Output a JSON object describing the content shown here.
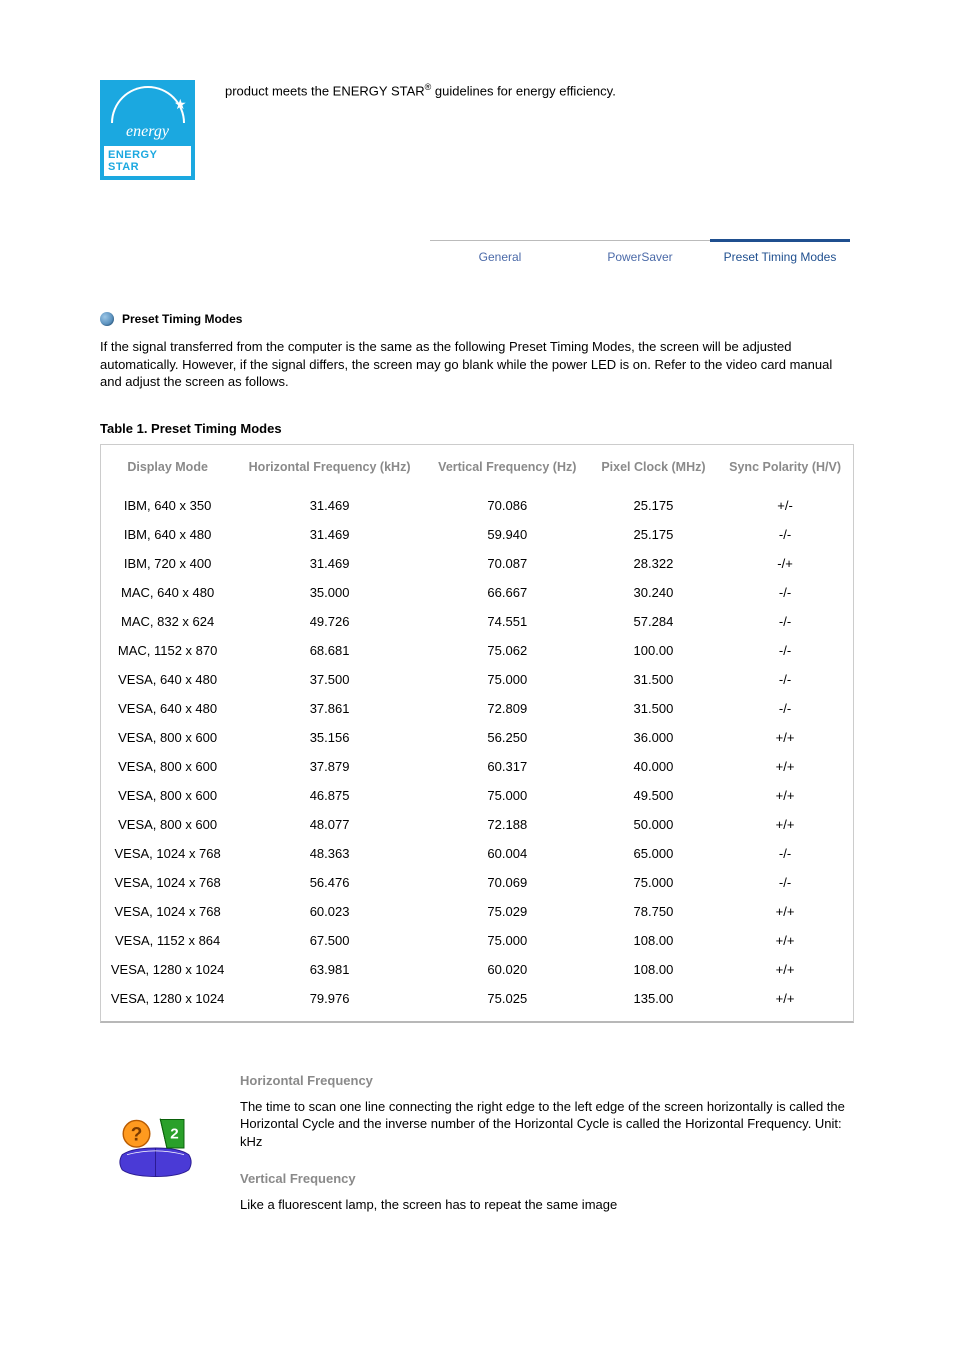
{
  "logo": {
    "script": "energy",
    "label": "ENERGY STAR"
  },
  "top_text": {
    "before_sup": "product meets the ENERGY STAR",
    "sup": "®",
    "after_sup": " guidelines for energy efficiency."
  },
  "tabs": {
    "general": "General",
    "powersaver": "PowerSaver",
    "preset": "Preset Timing Modes"
  },
  "section": {
    "title": "Preset Timing Modes",
    "intro": "If the signal transferred from the computer is the same as the following Preset Timing Modes, the screen will be adjusted automatically. However, if the signal differs, the screen may go blank while the power LED is on. Refer to the video card manual and adjust the screen as follows."
  },
  "table": {
    "caption": "Table 1. Preset Timing Modes",
    "headers": {
      "mode": "Display Mode",
      "hfreq": "Horizontal Frequency (kHz)",
      "vfreq": "Vertical Frequency (Hz)",
      "pclk": "Pixel Clock (MHz)",
      "sync": "Sync Polarity (H/V)"
    }
  },
  "chart_data": {
    "type": "table",
    "columns": [
      "Display Mode",
      "Horizontal Frequency (kHz)",
      "Vertical Frequency (Hz)",
      "Pixel Clock (MHz)",
      "Sync Polarity (H/V)"
    ],
    "rows": [
      {
        "mode": "IBM, 640 x 350",
        "hfreq": "31.469",
        "vfreq": "70.086",
        "pclk": "25.175",
        "sync": "+/-"
      },
      {
        "mode": "IBM, 640 x 480",
        "hfreq": "31.469",
        "vfreq": "59.940",
        "pclk": "25.175",
        "sync": "-/-"
      },
      {
        "mode": "IBM, 720 x 400",
        "hfreq": "31.469",
        "vfreq": "70.087",
        "pclk": "28.322",
        "sync": "-/+"
      },
      {
        "mode": "MAC, 640 x 480",
        "hfreq": "35.000",
        "vfreq": "66.667",
        "pclk": "30.240",
        "sync": "-/-"
      },
      {
        "mode": "MAC, 832 x 624",
        "hfreq": "49.726",
        "vfreq": "74.551",
        "pclk": "57.284",
        "sync": "-/-"
      },
      {
        "mode": "MAC, 1152 x 870",
        "hfreq": "68.681",
        "vfreq": "75.062",
        "pclk": "100.00",
        "sync": "-/-"
      },
      {
        "mode": "VESA, 640 x 480",
        "hfreq": "37.500",
        "vfreq": "75.000",
        "pclk": "31.500",
        "sync": "-/-"
      },
      {
        "mode": "VESA, 640 x 480",
        "hfreq": "37.861",
        "vfreq": "72.809",
        "pclk": "31.500",
        "sync": "-/-"
      },
      {
        "mode": "VESA, 800 x 600",
        "hfreq": "35.156",
        "vfreq": "56.250",
        "pclk": "36.000",
        "sync": "+/+"
      },
      {
        "mode": "VESA, 800 x 600",
        "hfreq": "37.879",
        "vfreq": "60.317",
        "pclk": "40.000",
        "sync": "+/+"
      },
      {
        "mode": "VESA, 800 x 600",
        "hfreq": "46.875",
        "vfreq": "75.000",
        "pclk": "49.500",
        "sync": "+/+"
      },
      {
        "mode": "VESA, 800 x 600",
        "hfreq": "48.077",
        "vfreq": "72.188",
        "pclk": "50.000",
        "sync": "+/+"
      },
      {
        "mode": "VESA, 1024 x 768",
        "hfreq": "48.363",
        "vfreq": "60.004",
        "pclk": "65.000",
        "sync": "-/-"
      },
      {
        "mode": "VESA, 1024 x 768",
        "hfreq": "56.476",
        "vfreq": "70.069",
        "pclk": "75.000",
        "sync": "-/-"
      },
      {
        "mode": "VESA, 1024 x 768",
        "hfreq": "60.023",
        "vfreq": "75.029",
        "pclk": "78.750",
        "sync": "+/+"
      },
      {
        "mode": "VESA, 1152 x 864",
        "hfreq": "67.500",
        "vfreq": "75.000",
        "pclk": "108.00",
        "sync": "+/+"
      },
      {
        "mode": "VESA, 1280 x 1024",
        "hfreq": "63.981",
        "vfreq": "60.020",
        "pclk": "108.00",
        "sync": "+/+"
      },
      {
        "mode": "VESA, 1280 x 1024",
        "hfreq": "79.976",
        "vfreq": "75.025",
        "pclk": "135.00",
        "sync": "+/+"
      }
    ]
  },
  "defs": {
    "h_heading": "Horizontal Frequency",
    "h_para": "The time to scan one line connecting the right edge to the left edge of the screen horizontally is called the Horizontal Cycle and the inverse number of the Horizontal Cycle is called the Horizontal Frequency. Unit: kHz",
    "v_heading": "Vertical Frequency",
    "v_para": "Like a fluorescent lamp, the screen has to repeat the same image"
  }
}
